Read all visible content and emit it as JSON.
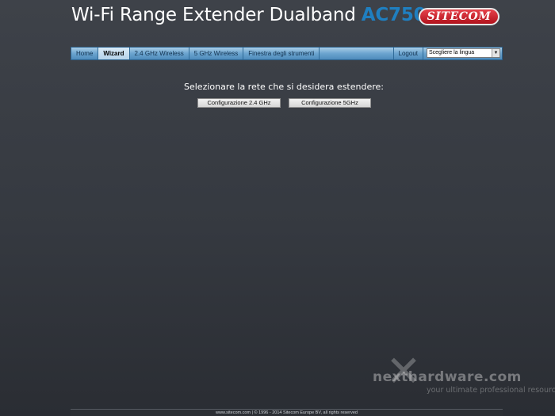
{
  "header": {
    "title": "Wi-Fi Range Extender Dualband",
    "model": "AC750",
    "logo_text": "SITECOM",
    "logo_color": "#d9232e",
    "model_color": "#1f7fc0"
  },
  "nav": {
    "items": [
      {
        "label": "Home",
        "active": false
      },
      {
        "label": "Wizard",
        "active": true
      },
      {
        "label": "2.4 GHz Wireless",
        "active": false
      },
      {
        "label": "5 GHz Wireless",
        "active": false
      },
      {
        "label": "Finestra degli strumenti",
        "active": false
      }
    ],
    "logout_label": "Logout",
    "language_select": {
      "value": "Scegliere la lingua"
    }
  },
  "main": {
    "prompt": "Selezionare la rete che si desidera estendere:",
    "buttons": {
      "config_24": "Configurazione 2.4 GHz",
      "config_5": "Configurazione 5GHz"
    }
  },
  "footer": {
    "text": "www.sitecom.com | © 1996 - 2014 Sitecom Europe BV, all rights reserved"
  },
  "watermark": {
    "brand": "nexthardware.com",
    "tagline": "your ultimate professional resource"
  },
  "colors": {
    "navbar_blue": "#6ba4cf",
    "background": "#3a3e45"
  }
}
